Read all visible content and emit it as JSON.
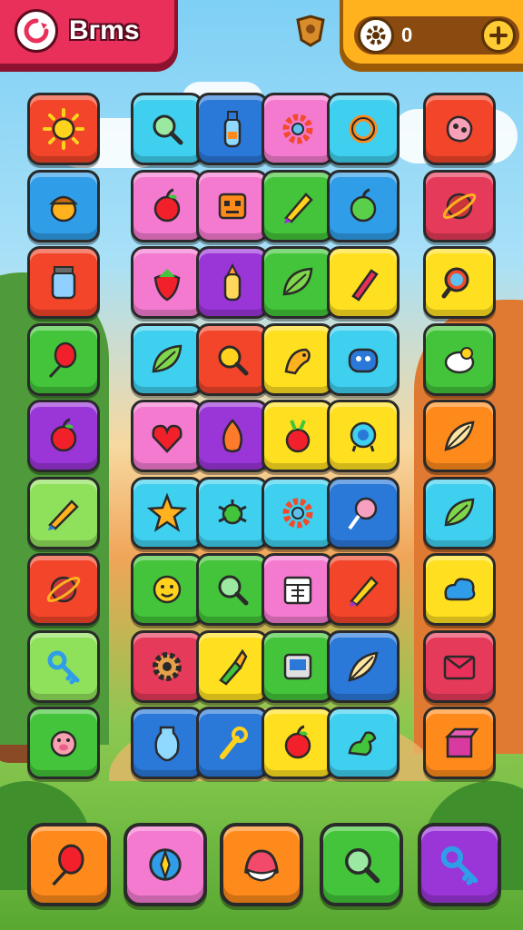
{
  "header": {
    "title": "Bгms",
    "score": "0",
    "title_icon": "swirl-logo-icon",
    "badge_icon": "shield-badge-icon",
    "currency_icon": "gear-icon",
    "add_icon": "plus-icon"
  },
  "colors": {
    "title_pill": "#e8305a",
    "score_bar": "#ffb21e",
    "tile_outline": "#2a2a2a"
  },
  "board": {
    "rows": [
      [
        {
          "icon": "sun-icon",
          "color": "red"
        },
        {
          "icon": "magnifier-icon",
          "color": "cyan"
        },
        {
          "icon": "bottle-icon",
          "color": "navy"
        },
        {
          "icon": "gear-ring-icon",
          "color": "pink"
        },
        {
          "icon": "ring-icon",
          "color": "cyan"
        },
        {
          "icon": "blob-icon",
          "color": "red"
        }
      ],
      [
        {
          "icon": "acorn-icon",
          "color": "blue"
        },
        {
          "icon": "apple-icon",
          "color": "pink"
        },
        {
          "icon": "robot-face-icon",
          "color": "pink"
        },
        {
          "icon": "pencil-icon",
          "color": "green"
        },
        {
          "icon": "green-apple-icon",
          "color": "blue"
        },
        {
          "icon": "planet-icon",
          "color": "rose"
        }
      ],
      [
        {
          "icon": "jar-icon",
          "color": "red"
        },
        {
          "icon": "strawberry-icon",
          "color": "pink"
        },
        {
          "icon": "baby-bottle-icon",
          "color": "purple"
        },
        {
          "icon": "leaf-icon",
          "color": "green"
        },
        {
          "icon": "marker-icon",
          "color": "yellow"
        },
        {
          "icon": "lens-icon",
          "color": "yellow"
        }
      ],
      [
        {
          "icon": "balloon-icon",
          "color": "green"
        },
        {
          "icon": "leaf-icon",
          "color": "cyan"
        },
        {
          "icon": "search-icon",
          "color": "red"
        },
        {
          "icon": "bird-icon",
          "color": "yellow"
        },
        {
          "icon": "monster-icon",
          "color": "cyan"
        },
        {
          "icon": "sheep-icon",
          "color": "green"
        }
      ],
      [
        {
          "icon": "apple-icon",
          "color": "purple"
        },
        {
          "icon": "heart-fruit-icon",
          "color": "pink"
        },
        {
          "icon": "onion-icon",
          "color": "purple"
        },
        {
          "icon": "radish-icon",
          "color": "yellow"
        },
        {
          "icon": "robot-icon",
          "color": "yellow"
        },
        {
          "icon": "feather-icon",
          "color": "orange"
        }
      ],
      [
        {
          "icon": "crayon-icon",
          "color": "lime"
        },
        {
          "icon": "star-icon",
          "color": "cyan"
        },
        {
          "icon": "bug-icon",
          "color": "cyan"
        },
        {
          "icon": "gear-ring-icon",
          "color": "cyan"
        },
        {
          "icon": "lollipop-icon",
          "color": "navy"
        },
        {
          "icon": "leaf-icon",
          "color": "cyan"
        }
      ],
      [
        {
          "icon": "planet-icon",
          "color": "red"
        },
        {
          "icon": "smiley-icon",
          "color": "green"
        },
        {
          "icon": "magnifier-icon",
          "color": "green"
        },
        {
          "icon": "calendar-icon",
          "color": "pink"
        },
        {
          "icon": "pencil-icon",
          "color": "red"
        },
        {
          "icon": "cloud-monster-icon",
          "color": "yellow"
        }
      ],
      [
        {
          "icon": "key-icon",
          "color": "lime"
        },
        {
          "icon": "cog-icon",
          "color": "rose"
        },
        {
          "icon": "brush-icon",
          "color": "yellow"
        },
        {
          "icon": "tv-icon",
          "color": "green"
        },
        {
          "icon": "feather-icon",
          "color": "navy"
        },
        {
          "icon": "box-face-icon",
          "color": "rose"
        }
      ],
      [
        {
          "icon": "pig-face-icon",
          "color": "green"
        },
        {
          "icon": "vase-icon",
          "color": "navy"
        },
        {
          "icon": "wrench-icon",
          "color": "navy"
        },
        {
          "icon": "apple-icon",
          "color": "yellow"
        },
        {
          "icon": "dinosaur-icon",
          "color": "cyan"
        },
        {
          "icon": "gift-box-icon",
          "color": "orange"
        }
      ]
    ]
  },
  "bottom_bar": [
    {
      "icon": "balloon-icon",
      "color": "orange"
    },
    {
      "icon": "compass-icon",
      "color": "pink"
    },
    {
      "icon": "shell-icon",
      "color": "orange"
    },
    {
      "icon": "magnifier-icon",
      "color": "green"
    },
    {
      "icon": "key-icon",
      "color": "purple"
    }
  ]
}
